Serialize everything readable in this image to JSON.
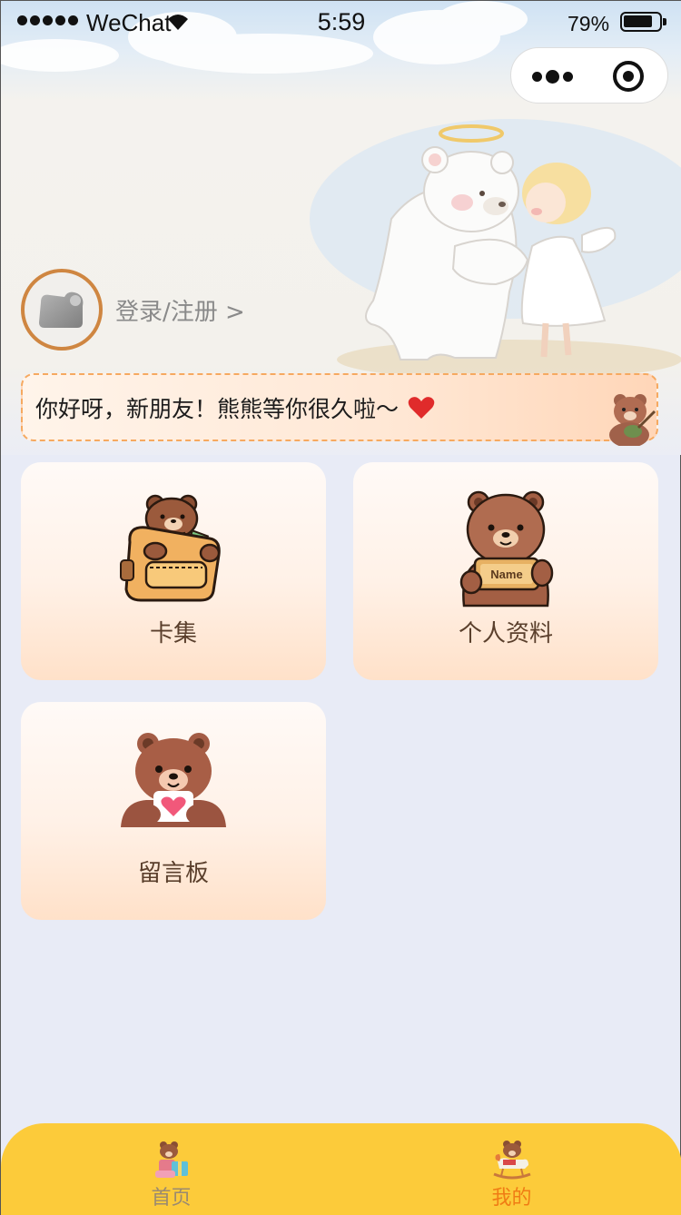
{
  "status_bar": {
    "carrier": "WeChat",
    "time": "5:59",
    "battery": "79%"
  },
  "profile": {
    "login_label": "登录/注册 >"
  },
  "greeting": {
    "text": "你好呀，新朋友！熊熊等你很久啦～"
  },
  "menu": {
    "items": [
      {
        "label": "卡集",
        "icon": "bear-backpack-icon"
      },
      {
        "label": "个人资料",
        "icon": "bear-name-card-icon"
      },
      {
        "label": "留言板",
        "icon": "bear-heart-note-icon"
      }
    ]
  },
  "tabbar": {
    "items": [
      {
        "label": "首页",
        "icon": "bear-gift-icon",
        "active": false
      },
      {
        "label": "我的",
        "icon": "bear-rocking-horse-icon",
        "active": true
      }
    ]
  },
  "colors": {
    "accent_orange": "#f07c14",
    "tabbar_yellow": "#fccb3a",
    "avatar_ring": "#cf8641",
    "greeting_border": "#f6a960",
    "page_bg": "#e8ebf6"
  }
}
